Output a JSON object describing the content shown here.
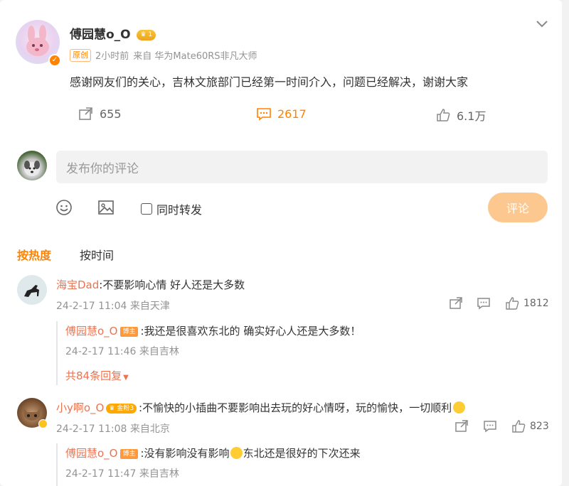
{
  "post": {
    "author": "傅园慧o_O",
    "vip_level": "1",
    "orig_tag": "原创",
    "time": "2小时前",
    "source": "来自 华为Mate60RS非凡大师",
    "text": "感谢网友们的关心，吉林文旅部门已经第一时间介入，问题已经解决，谢谢大家",
    "reposts": "655",
    "comments": "2617",
    "likes": "6.1万"
  },
  "composer": {
    "placeholder": "发布你的评论",
    "repost_label": "同时转发",
    "submit_label": "评论"
  },
  "tabs": {
    "hot": "按热度",
    "time": "按时间"
  },
  "comments": [
    {
      "user": "海宝Dad",
      "text": ":不要影响心情 好人还是大多数",
      "time": "24-2-17 11:04 来自天津",
      "likes": "1812",
      "reply": {
        "user": "傅园慧o_O",
        "badge": "博主",
        "text": ":我还是很喜欢东北的 确实好心人还是大多数！",
        "time": "24-2-17 11:46 来自吉林"
      },
      "more": "共84条回复"
    },
    {
      "user": "小y啊o_O",
      "fan_badge": "金粉3",
      "text": ":不愉快的小插曲不要影响出去玩的好心情呀，玩的愉快，一切顺利",
      "time": "24-2-17 11:08 来自北京",
      "likes": "823",
      "reply": {
        "user": "傅园慧o_O",
        "badge": "博主",
        "text_a": ":没有影响没有影响",
        "text_b": "东北还是很好的下次还来",
        "time": "24-2-17 11:47 来自吉林"
      }
    }
  ],
  "colors": {
    "accent": "#ff8200",
    "name": "#eb7350",
    "meta": "#939393"
  }
}
